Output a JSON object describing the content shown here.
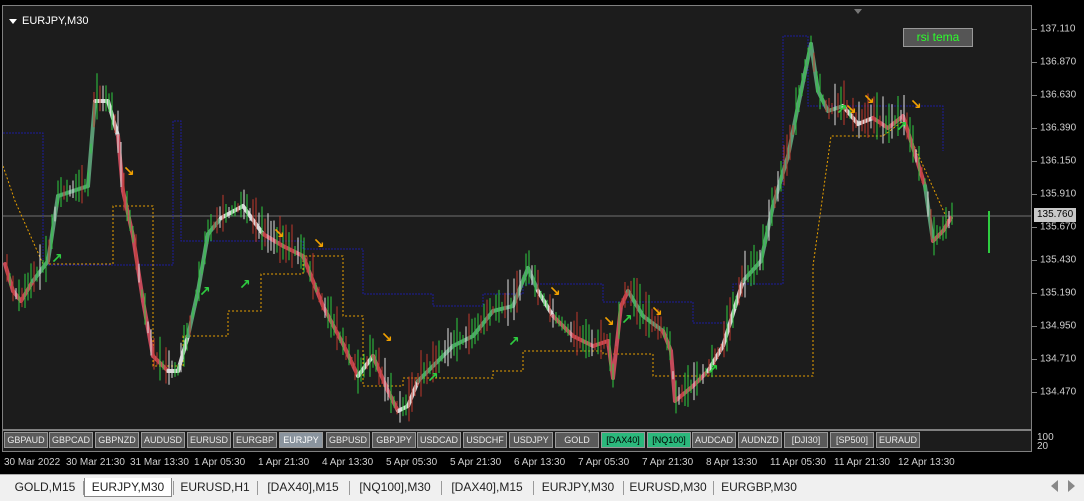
{
  "chart": {
    "title": "EURJPY,M30",
    "rsi_label": "rsi tema",
    "current_price": "135.760",
    "price_axis": [
      "137.110",
      "136.870",
      "136.630",
      "136.390",
      "136.150",
      "135.910",
      "135.670",
      "135.430",
      "135.190",
      "134.950",
      "134.710",
      "134.470"
    ],
    "time_axis": [
      "30 Mar 2022",
      "30 Mar 21:30",
      "31 Mar 13:30",
      "1 Apr 05:30",
      "1 Apr 21:30",
      "4 Apr 13:30",
      "5 Apr 05:30",
      "5 Apr 21:30",
      "6 Apr 13:30",
      "7 Apr 05:30",
      "7 Apr 21:30",
      "8 Apr 13:30",
      "11 Apr 05:30",
      "11 Apr 21:30",
      "12 Apr 13:30"
    ],
    "colors": {
      "bull": "#2ecc40",
      "bear": "#c0392b",
      "neutral": "#e0e0e0",
      "line_up": "#5a9a74",
      "line_down": "#c44a5a",
      "line_white": "#d8d8d8",
      "envelope": "#1c1c9c",
      "dotted": "#e8a000",
      "arrow_up": "#2ecc40",
      "arrow_down": "#f0a000"
    }
  },
  "symbols": [
    {
      "label": "GBPAUD",
      "state": "normal"
    },
    {
      "label": "GBPCAD",
      "state": "normal"
    },
    {
      "label": "GBPNZD",
      "state": "normal"
    },
    {
      "label": "AUDUSD",
      "state": "normal"
    },
    {
      "label": "EURUSD",
      "state": "normal"
    },
    {
      "label": "EURGBP",
      "state": "normal"
    },
    {
      "label": "EURJPY",
      "state": "selected"
    },
    {
      "label": "GBPUSD",
      "state": "normal"
    },
    {
      "label": "GBPJPY",
      "state": "normal"
    },
    {
      "label": "USDCAD",
      "state": "normal"
    },
    {
      "label": "USDCHF",
      "state": "normal"
    },
    {
      "label": "USDJPY",
      "state": "normal"
    },
    {
      "label": "GOLD",
      "state": "normal"
    },
    {
      "label": "[DAX40]",
      "state": "active"
    },
    {
      "label": "[NQ100]",
      "state": "active"
    },
    {
      "label": "AUDCAD",
      "state": "normal"
    },
    {
      "label": "AUDNZD",
      "state": "normal"
    },
    {
      "label": "[DJI30]",
      "state": "normal"
    },
    {
      "label": "[SP500]",
      "state": "normal"
    },
    {
      "label": "EURAUD",
      "state": "normal"
    }
  ],
  "indicator_scale": [
    "100",
    "20"
  ],
  "tabs": [
    {
      "label": "GOLD,M15",
      "active": false
    },
    {
      "label": "EURJPY,M30",
      "active": true
    },
    {
      "label": "EURUSD,H1",
      "active": false
    },
    {
      "label": "[DAX40],M15",
      "active": false
    },
    {
      "label": "[NQ100],M30",
      "active": false
    },
    {
      "label": "[DAX40],M15",
      "active": false
    },
    {
      "label": "EURJPY,M30",
      "active": false
    },
    {
      "label": "EURUSD,M30",
      "active": false
    },
    {
      "label": "EURGBP,M30",
      "active": false
    }
  ]
}
